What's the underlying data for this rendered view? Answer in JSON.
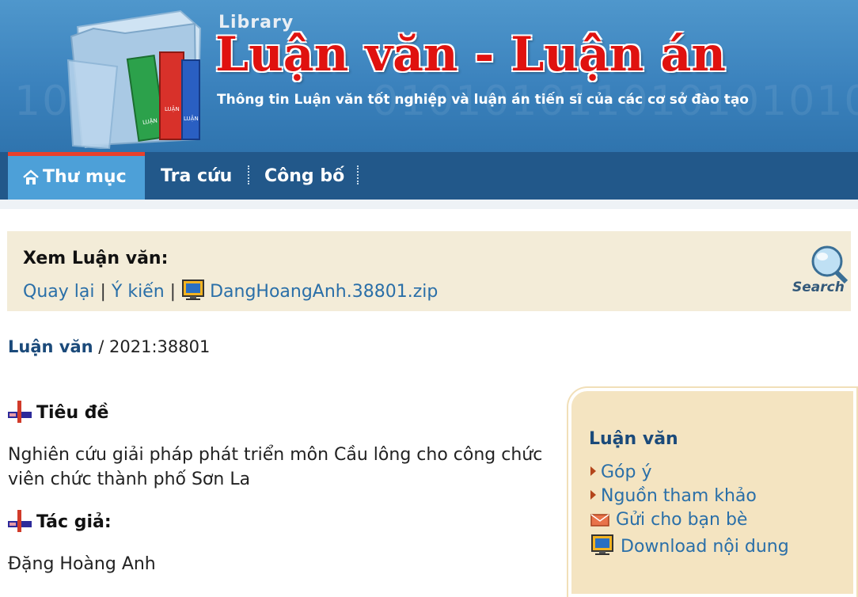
{
  "header": {
    "library_label": "Library",
    "site_title": "Luận văn - Luận án",
    "tagline": "Thông tin Luận văn tốt nghiệp và luận án tiến sĩ của các cơ sở đào tạo",
    "binary_bg_left": "10",
    "binary_bg_right": "0101010110101010100",
    "logo_book_labels": [
      "LUẬN",
      "LUẬN",
      "LUẬN"
    ]
  },
  "nav": {
    "items": [
      {
        "label": "Thư mục",
        "active": true,
        "icon": "home-icon"
      },
      {
        "label": "Tra cứu",
        "active": false
      },
      {
        "label": "Công bố",
        "active": false
      }
    ]
  },
  "view_panel": {
    "title": "Xem Luận văn:",
    "back_link": "Quay lại",
    "feedback_link": "Ý kiến",
    "separator": "|",
    "file_link": "DangHoangAnh.38801.zip",
    "file_icon": "zip-file-icon",
    "search_icon": "search-magnifier-icon",
    "search_label": "Search"
  },
  "record": {
    "type_label": "Luận văn",
    "id_text": " / 2021:38801"
  },
  "sections": [
    {
      "heading": "Tiêu đề",
      "body": " Nghiên cứu giải pháp phát triển môn Cầu lông cho công chức viên chức thành phố Sơn La",
      "icon": "cross-marker-icon"
    },
    {
      "heading": "Tác giả:",
      "body": " Đặng Hoàng Anh",
      "icon": "cross-marker-icon"
    }
  ],
  "sidebox": {
    "title": "Luận văn",
    "links": [
      {
        "label": "Góp ý",
        "icon": "arrow-right-icon"
      },
      {
        "label": "Nguồn tham khảo",
        "icon": "arrow-right-icon"
      },
      {
        "label": "Gửi cho bạn bè",
        "icon": "envelope-icon"
      },
      {
        "label": "Download nội dung",
        "icon": "download-icon"
      }
    ]
  },
  "colors": {
    "banner_blue": "#3b82bd",
    "nav_blue": "#22588a",
    "nav_active": "#4da0d8",
    "title_red": "#e0120f",
    "link_blue": "#2a6fa8",
    "panel_beige": "#f3ecd8"
  }
}
